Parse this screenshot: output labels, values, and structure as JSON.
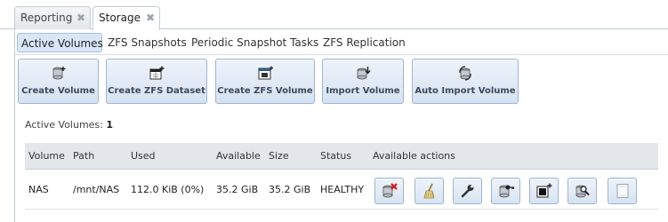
{
  "outer_tabs": [
    {
      "label": "Reporting",
      "close": "✖"
    },
    {
      "label": "Storage",
      "close": "✖"
    }
  ],
  "sub_tabs": [
    "Active Volumes",
    "ZFS Snapshots",
    "Periodic Snapshot Tasks",
    "ZFS Replication"
  ],
  "toolbar": {
    "create_volume": "Create Volume",
    "create_zfs_dataset": "Create ZFS Dataset",
    "create_zfs_volume": "Create ZFS Volume",
    "import_volume": "Import Volume",
    "auto_import_volume": "Auto Import Volume"
  },
  "active_volumes": {
    "label": "Active Volumes:",
    "count": "1"
  },
  "table": {
    "headers": [
      "Volume",
      "Path",
      "Used",
      "Available",
      "Size",
      "Status",
      "Available actions"
    ],
    "rows": [
      {
        "volume": "NAS",
        "path": "/mnt/NAS",
        "used": "112.0 KiB (0%)",
        "available": "35.2 GiB",
        "size": "35.2 GiB",
        "status": "HEALTHY"
      }
    ]
  },
  "row_action_icons": [
    "detach-icon",
    "scrub-broom-icon",
    "wrench-icon",
    "key-icon",
    "create-dataset-icon",
    "volume-status-icon",
    "blank-icon"
  ],
  "colors": {
    "button_border": "#9fb5d0",
    "active_subtab": "#d8e6f5",
    "header_bg": "#e3e7ec"
  }
}
